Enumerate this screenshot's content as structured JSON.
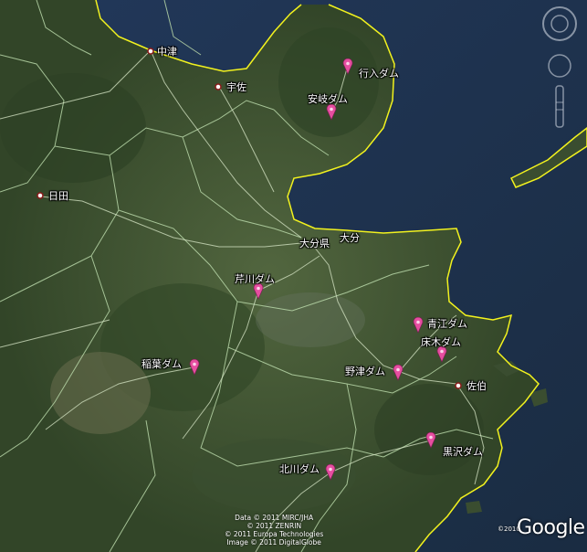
{
  "map": {
    "dams": [
      {
        "name": "行入ダム"
      },
      {
        "name": "安岐ダム"
      },
      {
        "name": "芹川ダム"
      },
      {
        "name": "青江ダム"
      },
      {
        "name": "床木ダム"
      },
      {
        "name": "野津ダム"
      },
      {
        "name": "稲葉ダム"
      },
      {
        "name": "黒沢ダム"
      },
      {
        "name": "北川ダム"
      }
    ],
    "cities": [
      {
        "name": "中津"
      },
      {
        "name": "宇佐"
      },
      {
        "name": "日田"
      },
      {
        "name": "佐伯"
      }
    ],
    "labels": {
      "prefecture": "大分県",
      "capital": "大分"
    },
    "attribution": {
      "line1": "Data © 2011 MIRC/JHA",
      "line2": "© 2011 ZENRIN",
      "line3": "© 2011 Europa Technologies",
      "line4": "Image © 2011 DigitalGlobe"
    },
    "logo": {
      "text": "Google",
      "year": "©2010"
    },
    "colors": {
      "sea": "#1d2f45",
      "land": "#3e5232",
      "pin": "#e64ea0",
      "coastline": "#f2f21e",
      "roads": "#d9e8c8",
      "borders": "#b8d7a8"
    }
  }
}
